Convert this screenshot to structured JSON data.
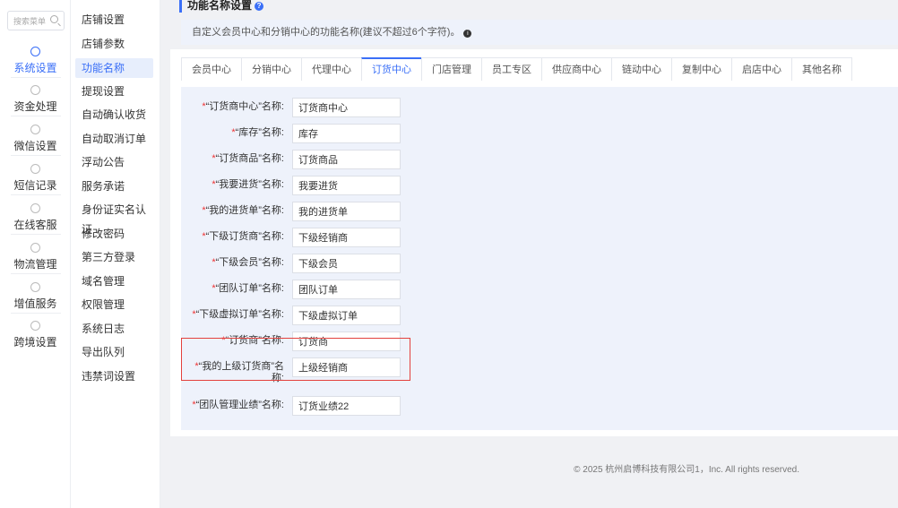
{
  "search": {
    "placeholder": "搜索菜单"
  },
  "rail": [
    {
      "label": "系统设置",
      "icon": "settings-icon",
      "active": true
    },
    {
      "label": "资金处理",
      "icon": "money-icon"
    },
    {
      "label": "微信设置",
      "icon": "wechat-icon"
    },
    {
      "label": "短信记录",
      "icon": "message-icon"
    },
    {
      "label": "在线客服",
      "icon": "headset-icon"
    },
    {
      "label": "物流管理",
      "icon": "truck-icon"
    },
    {
      "label": "增值服务",
      "icon": "chart-icon"
    },
    {
      "label": "跨境设置",
      "icon": "globe-icon"
    }
  ],
  "submenu": [
    "店铺设置",
    "店铺参数",
    "功能名称",
    "提现设置",
    "自动确认收货",
    "自动取消订单",
    "浮动公告",
    "服务承诺",
    "身份证实名认证",
    "修改密码",
    "第三方登录",
    "域名管理",
    "权限管理",
    "系统日志",
    "导出队列",
    "违禁词设置"
  ],
  "submenu_active": "功能名称",
  "page": {
    "title": "功能名称设置",
    "notice": "自定义会员中心和分销中心的功能名称(建议不超过6个字符)。"
  },
  "tabs": [
    "会员中心",
    "分销中心",
    "代理中心",
    "订货中心",
    "门店管理",
    "员工专区",
    "供应商中心",
    "链动中心",
    "复制中心",
    "启店中心",
    "其他名称"
  ],
  "active_tab": "订货中心",
  "fields": [
    {
      "label": "“订货商中心”名称:",
      "value": "订货商中心"
    },
    {
      "label": "“库存”名称:",
      "value": "库存"
    },
    {
      "label": "“订货商品”名称:",
      "value": "订货商品"
    },
    {
      "label": "“我要进货”名称:",
      "value": "我要进货"
    },
    {
      "label": "“我的进货单”名称:",
      "value": "我的进货单"
    },
    {
      "label": "“下级订货商”名称:",
      "value": "下级经销商"
    },
    {
      "label": "“下级会员”名称:",
      "value": "下级会员"
    },
    {
      "label": "“团队订单”名称:",
      "value": "团队订单"
    },
    {
      "label": "“下级虚拟订单”名称:",
      "value": "下级虚拟订单"
    },
    {
      "label": "“订货商”名称:",
      "value": "订货商"
    },
    {
      "label": "“我的上级订货商”名称:",
      "value": "上级经销商"
    },
    {
      "label": "“团队管理业绩”名称:",
      "value": "订货业绩22"
    }
  ],
  "footer": "© 2025 杭州启博科技有限公司1，Inc. All rights reserved."
}
